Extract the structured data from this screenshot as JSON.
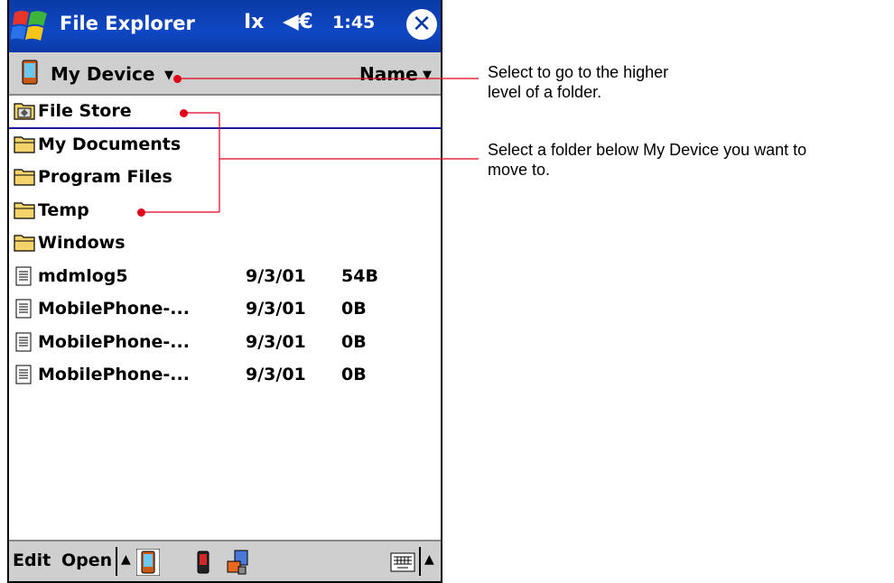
{
  "titlebar": {
    "title": "File Explorer",
    "connectivity": "Ix",
    "volume": "◀€",
    "time": "1:45",
    "close": "✕"
  },
  "folderbar": {
    "folder": "My Device",
    "sort": "Name"
  },
  "items": [
    {
      "name": "File Store",
      "date": "",
      "size": "",
      "type": "storage",
      "selected": true
    },
    {
      "name": "My Documents",
      "date": "",
      "size": "",
      "type": "folder"
    },
    {
      "name": "Program Files",
      "date": "",
      "size": "",
      "type": "folder"
    },
    {
      "name": "Temp",
      "date": "",
      "size": "",
      "type": "folder"
    },
    {
      "name": "Windows",
      "date": "",
      "size": "",
      "type": "folder"
    },
    {
      "name": "mdmlog5",
      "date": "9/3/01",
      "size": "54B",
      "type": "file"
    },
    {
      "name": "MobilePhone-...",
      "date": "9/3/01",
      "size": "0B",
      "type": "file"
    },
    {
      "name": "MobilePhone-...",
      "date": "9/3/01",
      "size": "0B",
      "type": "file"
    },
    {
      "name": "MobilePhone-...",
      "date": "9/3/01",
      "size": "0B",
      "type": "file"
    }
  ],
  "cmdbar": {
    "edit": "Edit",
    "open": "Open"
  },
  "callouts": [
    {
      "text": "Select to go to the higher\nlevel of a folder."
    },
    {
      "text": "Select a folder below My Device you want to\nmove to."
    }
  ],
  "colors": {
    "titlebar": "#0f47c4",
    "callout_line": "#e0001a",
    "bars": "#cfcfcf"
  }
}
